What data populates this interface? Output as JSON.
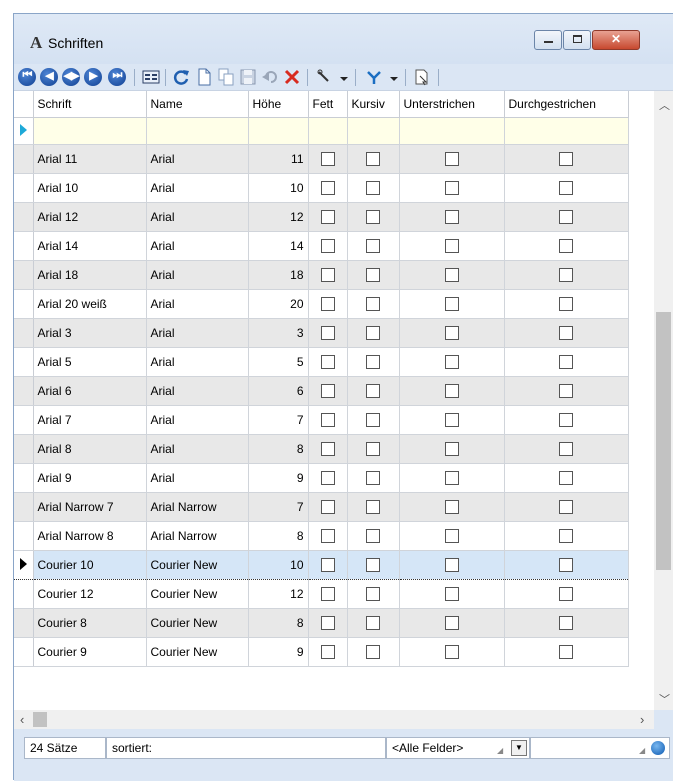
{
  "window": {
    "title": "Schriften",
    "title_icon": "A",
    "min_glyph": "",
    "close_glyph": "✕"
  },
  "toolbar": {
    "buttons": [
      "first-record",
      "previous-record",
      "page-nav",
      "next-record",
      "last-record",
      "grid-view",
      "refresh",
      "new",
      "copy",
      "save",
      "undo",
      "delete",
      "tools",
      "filter",
      "export"
    ]
  },
  "grid": {
    "columns": [
      "Schrift",
      "Name",
      "Höhe",
      "Fett",
      "Kursiv",
      "Unterstrichen",
      "Durchgestrichen"
    ],
    "rows": [
      {
        "schrift": "Arial 11",
        "name": "Arial",
        "hoehe": "11"
      },
      {
        "schrift": "Arial 10",
        "name": "Arial",
        "hoehe": "10"
      },
      {
        "schrift": "Arial 12",
        "name": "Arial",
        "hoehe": "12"
      },
      {
        "schrift": "Arial 14",
        "name": "Arial",
        "hoehe": "14"
      },
      {
        "schrift": "Arial 18",
        "name": "Arial",
        "hoehe": "18"
      },
      {
        "schrift": "Arial 20 weiß",
        "name": "Arial",
        "hoehe": "20"
      },
      {
        "schrift": "Arial 3",
        "name": "Arial",
        "hoehe": "3"
      },
      {
        "schrift": "Arial 5",
        "name": "Arial",
        "hoehe": "5"
      },
      {
        "schrift": "Arial 6",
        "name": "Arial",
        "hoehe": "6"
      },
      {
        "schrift": "Arial 7",
        "name": "Arial",
        "hoehe": "7"
      },
      {
        "schrift": "Arial 8",
        "name": "Arial",
        "hoehe": "8"
      },
      {
        "schrift": "Arial 9",
        "name": "Arial",
        "hoehe": "9"
      },
      {
        "schrift": "Arial Narrow 7",
        "name": "Arial Narrow",
        "hoehe": "7"
      },
      {
        "schrift": "Arial Narrow 8",
        "name": "Arial Narrow",
        "hoehe": "8"
      },
      {
        "schrift": "Courier 10",
        "name": "Courier New",
        "hoehe": "10"
      },
      {
        "schrift": "Courier 12",
        "name": "Courier New",
        "hoehe": "12"
      },
      {
        "schrift": "Courier 8",
        "name": "Courier New",
        "hoehe": "8"
      },
      {
        "schrift": "Courier 9",
        "name": "Courier New",
        "hoehe": "9"
      }
    ],
    "selected_row": "Courier 10"
  },
  "status": {
    "count": "24 Sätze",
    "sort_label": "sortiert:",
    "field_filter": "<Alle Felder>"
  },
  "colors": {
    "selection": "#d5e6f7",
    "new_row": "#ffffe8",
    "alt_row": "#e8e8e8"
  }
}
